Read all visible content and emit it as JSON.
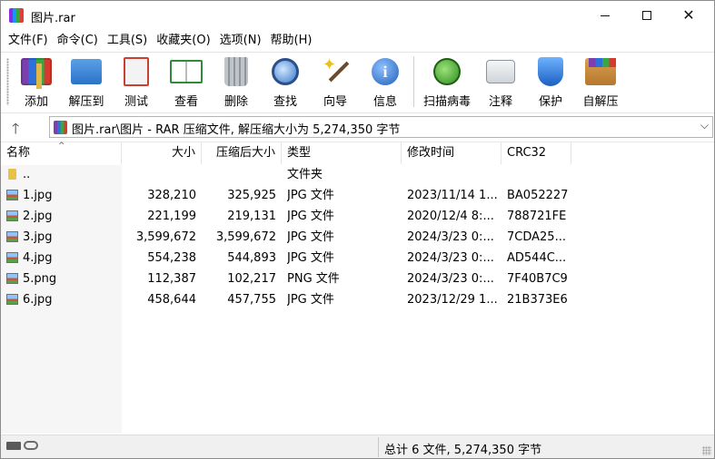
{
  "window": {
    "title": "图片.rar",
    "minimize": "",
    "maximize": "",
    "close": "✕"
  },
  "menu": [
    "文件(F)",
    "命令(C)",
    "工具(S)",
    "收藏夹(O)",
    "选项(N)",
    "帮助(H)"
  ],
  "toolbar": [
    {
      "label": "添加",
      "icon": "add-archive-icon"
    },
    {
      "label": "解压到",
      "icon": "extract-folder-icon"
    },
    {
      "label": "测试",
      "icon": "test-clipboard-icon"
    },
    {
      "label": "查看",
      "icon": "view-book-icon"
    },
    {
      "label": "删除",
      "icon": "trash-icon"
    },
    {
      "label": "查找",
      "icon": "magnifier-icon"
    },
    {
      "label": "向导",
      "icon": "magic-wand-icon"
    },
    {
      "label": "信息",
      "icon": "info-icon"
    },
    {
      "label": "扫描病毒",
      "icon": "virus-scan-icon"
    },
    {
      "label": "注释",
      "icon": "comment-icon"
    },
    {
      "label": "保护",
      "icon": "shield-icon"
    },
    {
      "label": "自解压",
      "icon": "sfx-box-icon"
    }
  ],
  "address": {
    "up": "🡑",
    "path": "图片.rar\\图片 - RAR 压缩文件, 解压缩大小为 5,274,350 字节",
    "dropdown": "⌵"
  },
  "columns": {
    "name": "名称",
    "size": "大小",
    "packed": "压缩后大小",
    "type": "类型",
    "modified": "修改时间",
    "crc": "CRC32"
  },
  "files": [
    {
      "name": "..",
      "size": "",
      "packed": "",
      "type": "文件夹",
      "modified": "",
      "crc": "",
      "kind": "folder"
    },
    {
      "name": "1.jpg",
      "size": "328,210",
      "packed": "325,925",
      "type": "JPG 文件",
      "modified": "2023/11/14 1...",
      "crc": "BA052227",
      "kind": "image"
    },
    {
      "name": "2.jpg",
      "size": "221,199",
      "packed": "219,131",
      "type": "JPG 文件",
      "modified": "2020/12/4 8:...",
      "crc": "788721FE",
      "kind": "image"
    },
    {
      "name": "3.jpg",
      "size": "3,599,672",
      "packed": "3,599,672",
      "type": "JPG 文件",
      "modified": "2024/3/23 0:...",
      "crc": "7CDA25...",
      "kind": "image"
    },
    {
      "name": "4.jpg",
      "size": "554,238",
      "packed": "544,893",
      "type": "JPG 文件",
      "modified": "2024/3/23 0:...",
      "crc": "AD544C...",
      "kind": "image"
    },
    {
      "name": "5.png",
      "size": "112,387",
      "packed": "102,217",
      "type": "PNG 文件",
      "modified": "2024/3/23 0:...",
      "crc": "7F40B7C9",
      "kind": "image"
    },
    {
      "name": "6.jpg",
      "size": "458,644",
      "packed": "457,755",
      "type": "JPG 文件",
      "modified": "2023/12/29 1...",
      "crc": "21B373E6",
      "kind": "image"
    }
  ],
  "status": {
    "summary": "总计 6 文件, 5,274,350 字节"
  },
  "colors": {
    "window_bg": "#ffffff",
    "left_pane_bg": "#f6f6f6",
    "statusbar_bg": "#f0f0f0"
  }
}
